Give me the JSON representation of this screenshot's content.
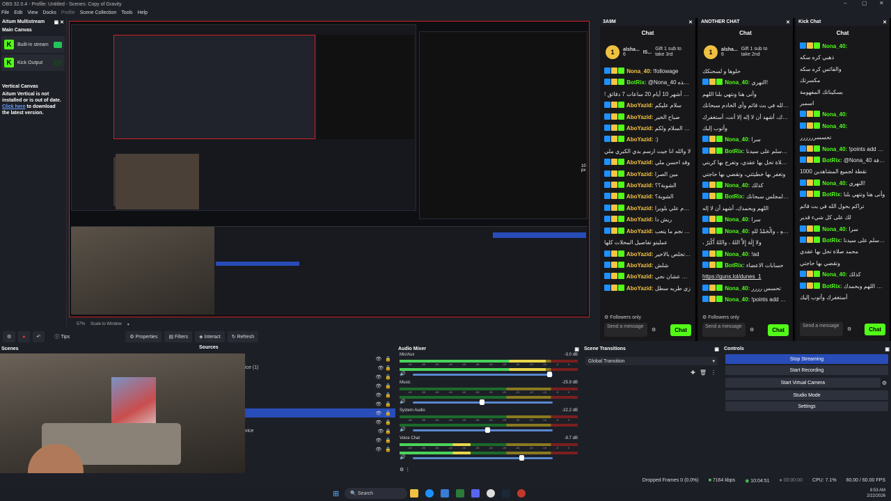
{
  "window": {
    "title": "OBS 32.0.4 - Profile: Untitled - Scenes: Copy of Gravity"
  },
  "menu": [
    "File",
    "Edit",
    "View",
    "Docks",
    "Profile",
    "Scene Collection",
    "Tools",
    "Help"
  ],
  "left_dock": {
    "title": "Aitum Multistream",
    "main_canvas": "Main Canvas",
    "outputs": [
      {
        "label": "Built-in stream"
      },
      {
        "label": "Kick Output"
      }
    ],
    "vertical_canvas": "Vertical Canvas",
    "vertical_msg": "Aitum Vertical is not installed or is out of date.",
    "click_here": "Click here",
    "download_msg": " to download the latest version."
  },
  "preview_mark": "10 px",
  "chat_panels": [
    {
      "tab": "3A9M",
      "title": "Chat",
      "gift_user": "alsha...",
      "gift_count": "6",
      "gift_user2": "IS...",
      "gift_msg": "Gift 1 sub to take 3rd",
      "messages": [
        [
          "y",
          "Nona_40",
          "!followage"
        ],
        [
          "g",
          "BotRix",
          "@Nona_40 بذلك هذه"
        ],
        [
          "",
          "",
          "! القناة ل 8 أشهر 10 أيام 20 ساعات 7 دقائق"
        ],
        [
          "y",
          "AboYazid",
          "سلام عليكم"
        ],
        [
          "y",
          "AboYazid",
          "صباح الخير"
        ],
        [
          "y",
          "AboYazid",
          "وعليكم السلام ولكم"
        ],
        [
          "y",
          "AboYazid",
          ":)"
        ],
        [
          "",
          "",
          "لا والله انا جيت ارسم بدي الكبري ملي"
        ],
        [
          "y",
          "AboYazid",
          "وقد احسن ملي"
        ],
        [
          "y",
          "AboYazid",
          "مين الصرا"
        ],
        [
          "y",
          "AboYazid",
          "الشوبة؟؟"
        ],
        [
          "y",
          "AboYazid",
          "الشوبة؟"
        ],
        [
          "y",
          "AboYazid",
          "بنقدم علي بلوبرا"
        ],
        [
          "y",
          "AboYazid",
          "ريش دا"
        ],
        [
          "y",
          "AboYazid",
          "وقد نجم ما يتعب"
        ],
        [
          "",
          "",
          "عمليتو تفاصيل المحلات كلها"
        ],
        [
          "y",
          "AboYazid",
          "الماء تخلص بالاخير"
        ],
        [
          "y",
          "AboYazid",
          "شلش"
        ],
        [
          "y",
          "AboYazid",
          "فيه سطل عشان نحي"
        ],
        [
          "y",
          "AboYazid",
          "زي طربه سطل"
        ]
      ]
    },
    {
      "tab": "ANOTHER CHAT",
      "title": "Chat",
      "gift_user": "alsha...",
      "gift_count": "6",
      "gift_msg": "Gift 1 sub to take 2nd",
      "messages": [
        [
          "",
          "",
          "حلوها و لسحنكك"
        ],
        [
          "g",
          "Nona_40",
          "النهري!"
        ],
        [
          "",
          "",
          "وأنى هنا ونتهي بلنا اللهم"
        ],
        [
          "",
          "",
          "تراكم بحول الله في بت قائم وأي الخادم سبحانك"
        ],
        [
          "",
          "",
          "اللهم وبحمدك، أشهد أن لا إله إلا أنت، أستغفرك"
        ],
        [
          "",
          "",
          "وأتوب إليك"
        ],
        [
          "g",
          "Nona_40",
          "سرا"
        ],
        [
          "g",
          "BotRix",
          "اللهم صل وسلم على سيدنا"
        ],
        [
          "",
          "",
          "محمد صلاة تحل بها عقدي، وتفرج بها كربتي،"
        ],
        [
          "",
          "",
          "وتغفر بها خطيئتي، وتقضي بها حاجتي"
        ],
        [
          "g",
          "Nona_40",
          "كذلك"
        ],
        [
          "g",
          "BotRix",
          "كذلك المجلس سبحانك"
        ],
        [
          "",
          "",
          "اللهم وبحمدك، أشهد أن لا إله"
        ],
        [
          "g",
          "Nona_40",
          "سرا"
        ],
        [
          "g",
          "Nona_40",
          "سُبْحَانَ اللهِ ، والْحَمْدُ للهِ"
        ],
        [
          "",
          "",
          "، ولا إِلَهَ إِلاَّ اللهُ ، واللهُ أَكْبَرُ"
        ],
        [
          "g",
          "Nona_40",
          "!ad"
        ],
        [
          "g",
          "BotRix",
          "حسابات الاعضاء"
        ],
        [
          "",
          "",
          "https://guns.lol/dunes_1"
        ],
        [
          "g",
          "Nona_40",
          "تحسس رررر"
        ],
        [
          "g",
          "Nona_40",
          "!points add all 1000"
        ],
        [
          "g",
          "BotRix",
          "@Nona_40 تمت إضافة"
        ],
        [
          "",
          "",
          "1000 نقطة لجميع المشاهدين"
        ]
      ]
    },
    {
      "tab": "Kick Chat",
      "title": "Chat",
      "messages": [
        [
          "g",
          "Nona_40",
          ""
        ],
        [
          "",
          "",
          "ذهبي كره سكه"
        ],
        [
          "",
          "",
          "والفائس كره سكه"
        ],
        [
          "",
          "",
          "مكسرتك"
        ],
        [
          "",
          "",
          "بسكيناتك المفهومة"
        ],
        [
          "",
          "",
          "اسمبر"
        ],
        [
          "g",
          "Nona_40",
          ""
        ],
        [
          "g",
          "Nona_40",
          ""
        ],
        [
          "",
          "",
          "تحسسرررررر"
        ],
        [
          "g",
          "Nona_40",
          "!points add all 1000"
        ],
        [
          "g",
          "BotRix",
          "@Nona_40 تمت إضافة"
        ],
        [
          "",
          "",
          "1000 نقطة لجميع المشاهدين"
        ],
        [
          "g",
          "Nona_40",
          "النهري!"
        ],
        [
          "g",
          "BotRix",
          "وأنى هنا ونتهي بلنا"
        ],
        [
          "",
          "",
          "تراكم بحول الله في بت قائم"
        ],
        [
          "",
          "",
          "لك على كل شيء قدير"
        ],
        [
          "g",
          "Nona_40",
          "سرا"
        ],
        [
          "g",
          "BotRix",
          "اللهم صل وسلم على سيدنا"
        ],
        [
          "",
          "",
          "محمد صلاة تحل بها عقدي"
        ],
        [
          "",
          "",
          "وتقضي بها حاجتي"
        ],
        [
          "g",
          "Nona_40",
          "كذلك"
        ],
        [
          "g",
          "BotRix",
          "سبحانك اللهم وبحمدك"
        ],
        [
          "",
          "",
          "أستغفرك وأتوب إليك"
        ],
        [
          "g",
          "Nona_40",
          "سرا"
        ],
        [
          "g",
          "Nona_40",
          "سُبْحَانَ اللهِ ، والْحَمْدُ للهِ"
        ]
      ]
    }
  ],
  "chat_footer": {
    "followers": "Followers only",
    "send": "Send a message",
    "btn": "Chat"
  },
  "zoom": {
    "level": "57%",
    "mode": "Scale to Window"
  },
  "toolbar": {
    "tips": "Tips",
    "properties": "Properties",
    "filters": "Filters",
    "interact": "Interact",
    "refresh": "Refresh"
  },
  "docks": {
    "scenes": "Scenes",
    "sources": "Sources",
    "mixer": "Audio Mixer",
    "transitions": "Scene Transitions",
    "controls": "Controls"
  },
  "sources_partial": [
    "ice (1)",
    "vice"
  ],
  "mixer": [
    {
      "name": "Mic/Aux",
      "db": "-3.0 dB",
      "level": 0.82,
      "vol": 0.96
    },
    {
      "name": "Music",
      "db": "-25.9 dB",
      "level": 0.0,
      "vol": 0.48
    },
    {
      "name": "System Audio",
      "db": "-22.2 dB",
      "level": 0.0,
      "vol": 0.52
    },
    {
      "name": "Voice Chat",
      "db": "-9.7 dB",
      "level": 0.4,
      "vol": 0.76
    }
  ],
  "meter_ticks": [
    "-60",
    "-55",
    "-50",
    "-45",
    "-40",
    "-35",
    "-30",
    "-25",
    "-20",
    "-15",
    "-10",
    "-5",
    "0"
  ],
  "transition": {
    "value": "Global Transition"
  },
  "controls": [
    "Stop Streaming",
    "Start Recording",
    "Start Virtual Camera",
    "Studio Mode",
    "Settings"
  ],
  "status": {
    "dropped": "Dropped Frames 0 (0.0%)",
    "kbps": "7164 kbps",
    "live_time": "10:04:51",
    "rec_time": "00:00:00",
    "cpu": "CPU: 7.1%",
    "fps": "60.00 / 60.00 FPS"
  },
  "taskbar": {
    "search": "Search",
    "time": "8:53 AM",
    "date": "2/22/2026"
  },
  "colors": {
    "accent": "#53fc18",
    "stream_btn": "#284cb8",
    "preview_border": "#d02020"
  }
}
